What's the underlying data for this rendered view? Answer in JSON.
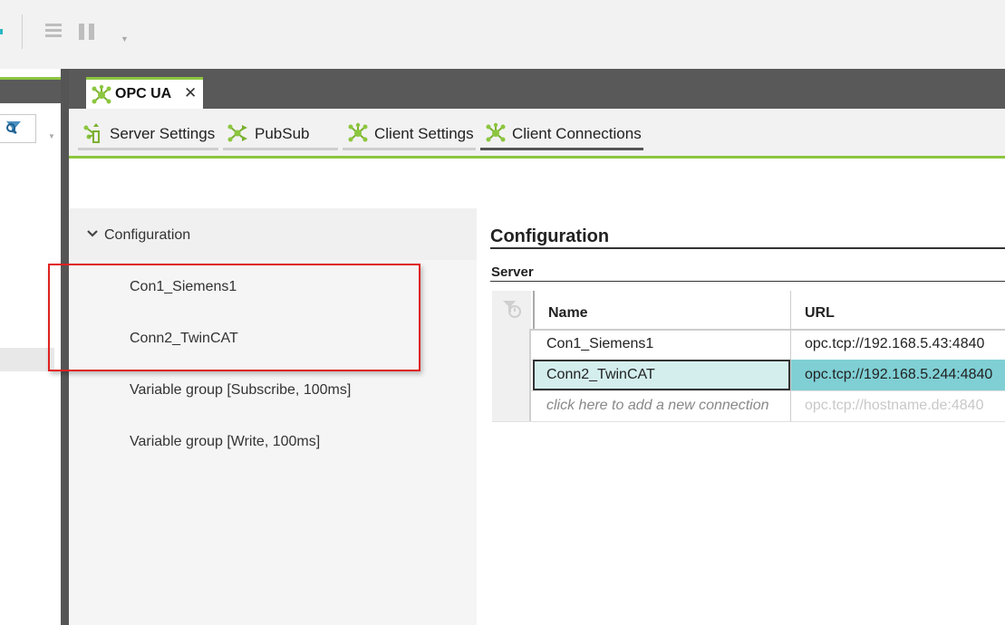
{
  "toolbar": {
    "icons": [
      "list-icon",
      "pause-icon",
      "dropdown-caret-icon"
    ]
  },
  "left_pane": {
    "icons": [
      "filter-icon"
    ]
  },
  "tab": {
    "label": "OPC UA",
    "close": "✕",
    "icon": "network-node-icon"
  },
  "subtabs": [
    {
      "label": "Server Settings",
      "icon": "server-settings-icon"
    },
    {
      "label": "PubSub",
      "icon": "pubsub-icon"
    },
    {
      "label": "Client Settings",
      "icon": "network-node-icon"
    },
    {
      "label": "Client Connections",
      "icon": "network-node-icon",
      "active": true
    }
  ],
  "tree": {
    "header": "Configuration",
    "items": [
      "Con1_Siemens1",
      "Conn2_TwinCAT",
      "Variable group [Subscribe, 100ms]",
      "Variable group [Write, 100ms]"
    ]
  },
  "content": {
    "title": "Configuration",
    "section": "Server",
    "columns": {
      "name": "Name",
      "url": "URL"
    },
    "rows": [
      {
        "name": "Con1_Siemens1",
        "url": "opc.tcp://192.168.5.43:4840"
      },
      {
        "name": "Conn2_TwinCAT",
        "url": "opc.tcp://192.168.5.244:4840"
      },
      {
        "name": "click here to add a new connection",
        "url": "opc.tcp://hostname.de:4840"
      }
    ]
  },
  "colors": {
    "accent_green": "#8cc63f",
    "selection_teal": "#7fcfd4",
    "highlight_red": "#e02020"
  }
}
